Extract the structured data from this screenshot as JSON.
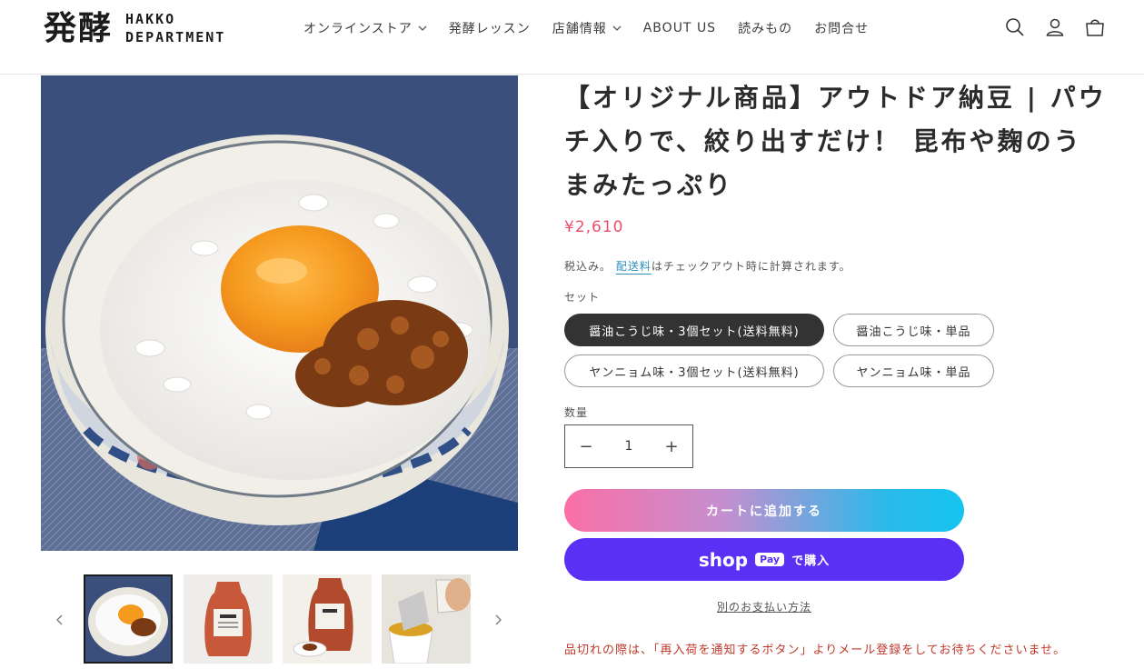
{
  "header": {
    "logo_kanji": "発酵",
    "logo_line1": "HAKKO",
    "logo_line2": "DEPARTMENT",
    "nav": [
      {
        "label": "オンラインストア",
        "has_dropdown": true
      },
      {
        "label": "発酵レッスン",
        "has_dropdown": false
      },
      {
        "label": "店舗情報",
        "has_dropdown": true
      },
      {
        "label": "ABOUT US",
        "has_dropdown": false
      },
      {
        "label": "読みもの",
        "has_dropdown": false
      },
      {
        "label": "お問合せ",
        "has_dropdown": false
      }
    ],
    "icons": [
      "search-icon",
      "account-icon",
      "cart-icon"
    ]
  },
  "product": {
    "title": "【オリジナル商品】アウトドア納豆 | パウチ入りで、絞り出すだけ！ 昆布や麹のうまみたっぷり",
    "price": "¥2,610",
    "tax_prefix": "税込み。",
    "tax_link": "配送料",
    "tax_suffix": "はチェックアウト時に計算されます。",
    "variant_label": "セット",
    "variants": [
      {
        "label": "醤油こうじ味・3個セット(送料無料)",
        "selected": true
      },
      {
        "label": "醤油こうじ味・単品",
        "selected": false
      },
      {
        "label": "ヤンニョム味・3個セット(送料無料)",
        "selected": false
      },
      {
        "label": "ヤンニョム味・単品",
        "selected": false
      }
    ],
    "quantity_label": "数量",
    "quantity": "1",
    "minus": "−",
    "plus": "+",
    "add_to_cart": "カートに追加する",
    "shoppay_shop": "shop",
    "shoppay_pay": "Pay",
    "shoppay_buy": "で購入",
    "other_payment": "別のお支払い方法",
    "notice": "品切れの際は、「再入荷を通知するボタン」よりメール登録をしてお待ちくださいませ。"
  },
  "colors": {
    "price": "#e94f6b",
    "shoppay": "#5a31f4",
    "notice": "#c0392b",
    "selected_variant": "#333333"
  }
}
